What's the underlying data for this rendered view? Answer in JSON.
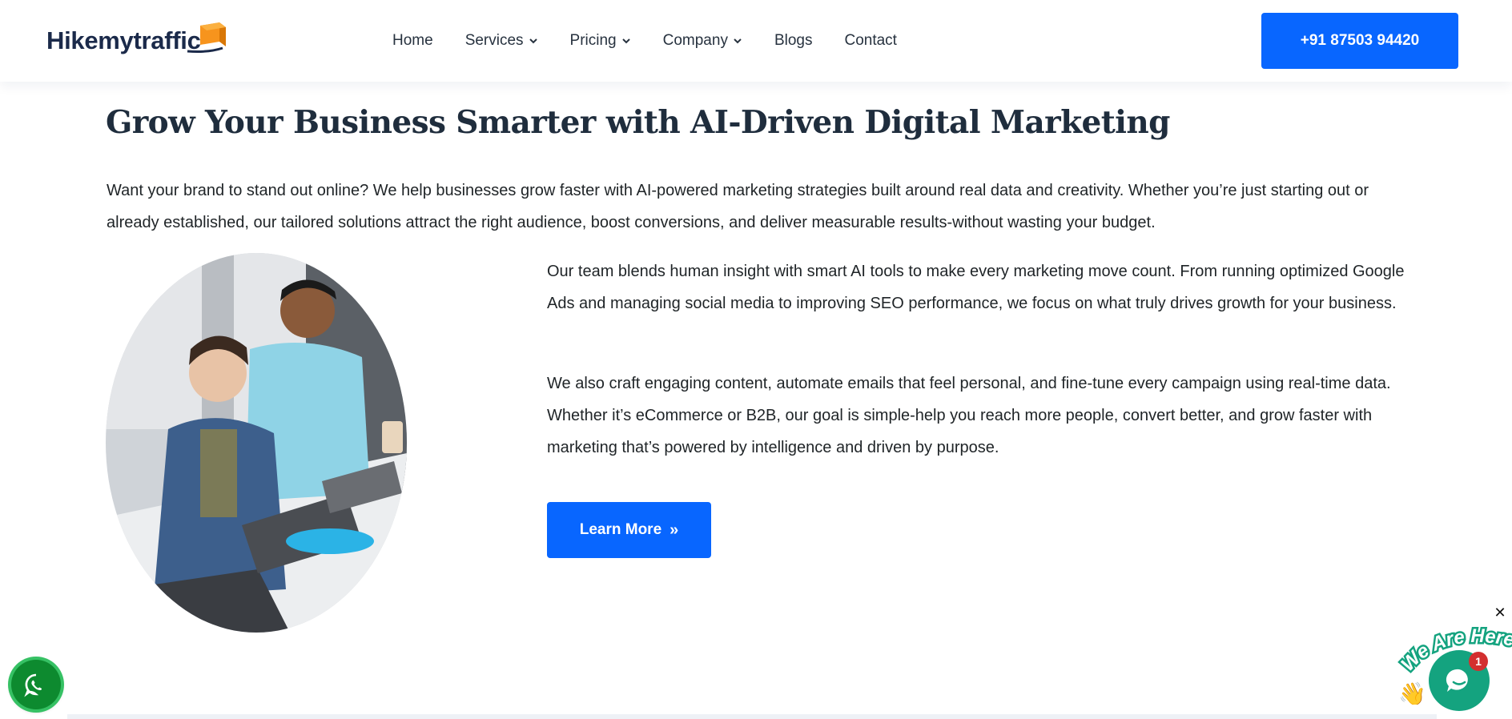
{
  "brand": {
    "name": "Hikemytraffic"
  },
  "nav": {
    "items": [
      {
        "label": "Home",
        "dropdown": false
      },
      {
        "label": "Services",
        "dropdown": true
      },
      {
        "label": "Pricing",
        "dropdown": true
      },
      {
        "label": "Company",
        "dropdown": true
      },
      {
        "label": "Blogs",
        "dropdown": false
      },
      {
        "label": "Contact",
        "dropdown": false
      }
    ],
    "phone": "+91 87503 94420"
  },
  "hero": {
    "title": "Grow Your Business Smarter with AI-Driven Digital Marketing",
    "intro": "Want your brand to stand out online? We help businesses grow faster with AI-powered marketing strategies built around real data and creativity. Whether you’re just starting out or already established, our tailored solutions attract the right audience, boost conversions, and deliver measurable results-without wasting your budget.",
    "paragraph1": "Our team blends human insight with smart AI tools to make every marketing move count. From running optimized Google Ads and managing social media to improving SEO performance, we focus on what truly drives growth for your business.",
    "paragraph2": "We also craft engaging content, automate emails that feel personal, and fine-tune every campaign using real-time data. Whether it’s eCommerce or B2B, our goal is simple-help you reach more people, convert better, and grow faster with marketing that’s powered by intelligence and driven by purpose.",
    "cta": "Learn More"
  },
  "widgets": {
    "chat_tagline": "We Are Here!",
    "chat_badge": "1",
    "close_glyph": "✕"
  },
  "colors": {
    "primary": "#0866ff",
    "heading": "#1f2d3d",
    "whatsapp": "#0d8a2f",
    "chat": "#14a37f",
    "badge": "#d32f2f"
  }
}
